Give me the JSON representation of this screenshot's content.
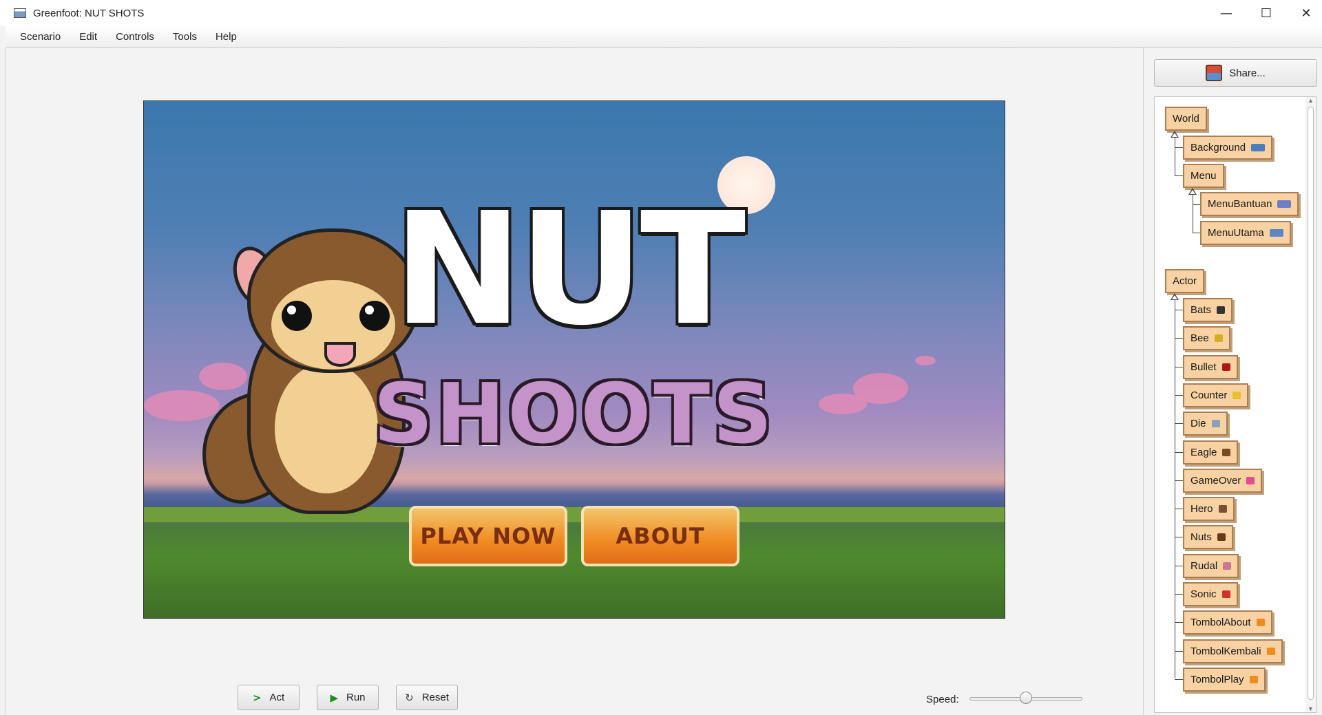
{
  "window": {
    "title": "Greenfoot: NUT SHOTS"
  },
  "window_controls": {
    "minimize": "—",
    "maximize": "☐",
    "close": "✕"
  },
  "menu": [
    "Scenario",
    "Edit",
    "Controls",
    "Tools",
    "Help"
  ],
  "world_view": {
    "title_line1": "NUT",
    "title_line2": "SHOOTS",
    "play_button": "PLAY NOW",
    "about_button": "ABOUT"
  },
  "share_button": "Share...",
  "class_tree": {
    "world_root": "World",
    "world_classes": [
      {
        "name": "Background",
        "icon": "sky-thumbnail",
        "color": "#4a7fbf"
      },
      {
        "name": "Menu",
        "icon": "",
        "color": ""
      },
      {
        "name": "MenuBantuan",
        "icon": "menu-thumbnail",
        "color": "#6d7fc2"
      },
      {
        "name": "MenuUtama",
        "icon": "menu-thumbnail",
        "color": "#5e86c4"
      }
    ],
    "actor_root": "Actor",
    "actor_classes": [
      {
        "name": "Bats",
        "icon": "bat-icon",
        "color": "#333333"
      },
      {
        "name": "Bee",
        "icon": "bee-icon",
        "color": "#d4b020"
      },
      {
        "name": "Bullet",
        "icon": "bullet-icon",
        "color": "#b01818"
      },
      {
        "name": "Counter",
        "icon": "counter-icon",
        "color": "#e8c030"
      },
      {
        "name": "Die",
        "icon": "die-icon",
        "color": "#8aa0b8"
      },
      {
        "name": "Eagle",
        "icon": "eagle-icon",
        "color": "#7a4a20"
      },
      {
        "name": "GameOver",
        "icon": "gameover-icon",
        "color": "#e0508a"
      },
      {
        "name": "Hero",
        "icon": "hero-icon",
        "color": "#7a5030"
      },
      {
        "name": "Nuts",
        "icon": "nut-icon",
        "color": "#6a3818"
      },
      {
        "name": "Rudal",
        "icon": "rudal-icon",
        "color": "#c87890"
      },
      {
        "name": "Sonic",
        "icon": "sonic-icon",
        "color": "#d03030"
      },
      {
        "name": "TombolAbout",
        "icon": "button-icon",
        "color": "#f08a22"
      },
      {
        "name": "TombolKembali",
        "icon": "button-icon",
        "color": "#f08a22"
      },
      {
        "name": "TombolPlay",
        "icon": "button-icon",
        "color": "#f08a22"
      }
    ]
  },
  "controls": {
    "act": "Act",
    "run": "Run",
    "reset": "Reset",
    "speed_label": "Speed:",
    "speed_value": 0.5
  }
}
